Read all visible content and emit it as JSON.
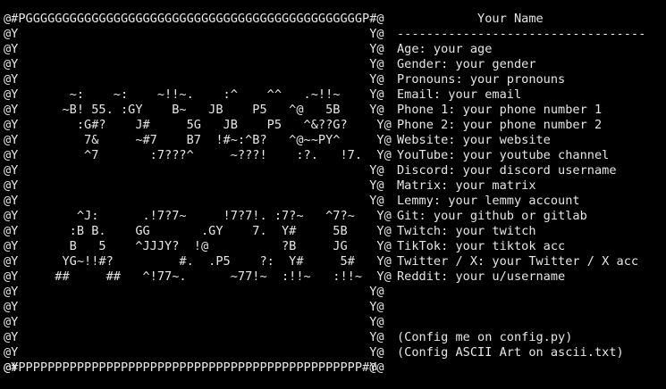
{
  "colors": {
    "background": "#000000",
    "foreground": "#e6e6e6"
  },
  "ascii_art": {
    "lines": [
      "@#PGGGGGGGGGGGGGGGGGGGGGGGGGGGGGGGGGGGGGGGGGGGGGGP#@",
      "@Y                                                Y@",
      "@Y                                                Y@",
      "@Y                                                Y@",
      "@Y                                                Y@",
      "@Y       ~:    ~:    ~!!~.    :^    ^^   .~!!~    Y@",
      "@Y      ~B! 55. :GY    B~   JB    P5   ^@   5B    Y@",
      "@Y        :G#?    J#     5G   JB    P5   ^&??G?    Y@",
      "@Y         7&     ~#7    B7  !#~:^B?   ^@~~PY^     Y@",
      "@Y         ^7       :7???^     ~???!    :?.   !7.  Y@",
      "@Y                                                Y@",
      "@Y                                                Y@",
      "@Y                                                Y@",
      "@Y        ^J:      .!7?7~     !7?7!. :7?~   ^7?~   Y@",
      "@Y       :B B.    GG       .GY    7.  Y#     5B    Y@",
      "@Y       B   5    ^JJJY?  !@          ?B     JG    Y@",
      "@Y      YG~!!#?         #.  .P5    ?:  Y#     5#   Y@",
      "@Y     ##     ##   ^!77~.      ~77!~  :!!~   :!!~  Y@",
      "@Y                                                Y@",
      "@Y                                                Y@",
      "@Y                                                Y@",
      "@Y                                                Y@",
      "@Y                                                Y@",
      "@Y                                                Y@",
      "@#PPPPPPPPPPPPPPPPPPPPPPPPPPPPPPPPPPPPPPPPPPPPPPP#@"
    ]
  },
  "info": {
    "title": "           Your Name",
    "separator": "----------------------------------",
    "rows": [
      {
        "text": "Age: your age"
      },
      {
        "text": "Gender: your gender"
      },
      {
        "text": "Pronouns: your pronouns"
      },
      {
        "text": "Email: your email"
      },
      {
        "text": "Phone 1: your phone number 1"
      },
      {
        "text": "Phone 2: your phone number 2"
      },
      {
        "text": "Website: your website"
      },
      {
        "text": "YouTube: your youtube channel"
      },
      {
        "text": "Discord: your discord username"
      },
      {
        "text": "Matrix: your matrix"
      },
      {
        "text": "Lemmy: your lemmy account"
      },
      {
        "text": "Git: your github or gitlab"
      },
      {
        "text": "Twitch: your twitch"
      },
      {
        "text": "TikTok: your tiktok acc"
      },
      {
        "text": "Twitter / X: your Twitter / X acc"
      },
      {
        "text": "Reddit: your u/username"
      }
    ],
    "footer": [
      {
        "text": "(Config me on config.py)"
      },
      {
        "text": "(Config ASCII Art on ascii.txt)"
      }
    ]
  }
}
